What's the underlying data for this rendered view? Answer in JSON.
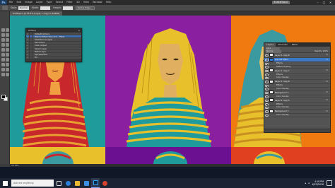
{
  "app": {
    "logo": "Ps",
    "menus": [
      "File",
      "Edit",
      "Image",
      "Layer",
      "Type",
      "Select",
      "Filter",
      "3D",
      "View",
      "Window",
      "Help"
    ],
    "workspace": "ESSENTIALS",
    "window_controls": [
      "–",
      "□",
      "✕"
    ]
  },
  "options": {
    "style_label": "Style:",
    "style_value": "Normal",
    "width_label": "Width:",
    "height_label": "Height:",
    "refine_button": "Refine Edge..."
  },
  "document": {
    "tab_title": "Untitled-1 @ 33.3% (Layer 1 copy 4, RGB/8)"
  },
  "actions_panel": {
    "title": "Actions",
    "rows": [
      {
        "check": "✓",
        "label": "Default Actions",
        "selected": false
      },
      {
        "check": "✓",
        "label": "Warhol Effect (Pop Art) - FINAL",
        "selected": true
      },
      {
        "check": "✓",
        "label": "Selection to Layer",
        "selected": false
      },
      {
        "check": "✓",
        "label": "Set Colors",
        "selected": false
      },
      {
        "check": "✓",
        "label": "Color Adjust",
        "selected": false
      },
      {
        "check": "✓",
        "label": "Select Layer",
        "selected": false
      },
      {
        "check": "✓",
        "label": "Make Layer",
        "selected": false
      },
      {
        "check": "✓",
        "label": "Set Selection",
        "selected": false
      },
      {
        "check": "✓",
        "label": "Fill",
        "selected": false
      }
    ]
  },
  "layers_panel": {
    "tabs": [
      "Layers",
      "Channels",
      "Paths"
    ],
    "kind": "Kind",
    "mode": "Normal",
    "opacity": "Opacity: 100%",
    "fill": "Fill: 100%",
    "rows": [
      {
        "name": "Layer 1 copy 8",
        "type": "layer",
        "thumb": "white",
        "selected": false
      },
      {
        "name": "pop art effect",
        "type": "layer",
        "thumb": "blue",
        "selected": true
      },
      {
        "name": "Effects",
        "type": "sub",
        "selected": false
      },
      {
        "name": "Pattern Overlay",
        "type": "sub",
        "selected": false
      },
      {
        "name": "Layer 1 copy 7",
        "type": "layer",
        "thumb": "white",
        "selected": false
      },
      {
        "name": "Effects",
        "type": "sub",
        "selected": false
      },
      {
        "name": "Color Overlay",
        "type": "sub",
        "selected": false
      },
      {
        "name": "Layer 1 copy 6",
        "type": "layer",
        "thumb": "white",
        "selected": false
      },
      {
        "name": "Effects",
        "type": "sub",
        "selected": false
      },
      {
        "name": "Color Overlay",
        "type": "sub",
        "selected": false
      },
      {
        "name": "Background 4",
        "type": "layer",
        "thumb": "white",
        "selected": false
      },
      {
        "name": "Color Overlay",
        "type": "sub",
        "selected": false
      },
      {
        "name": "Layer 1 copy 5",
        "type": "layer",
        "thumb": "white",
        "selected": false
      },
      {
        "name": "Effects",
        "type": "sub",
        "selected": false
      },
      {
        "name": "Color Overlay",
        "type": "sub",
        "selected": false
      },
      {
        "name": "Background 3",
        "type": "layer",
        "thumb": "white",
        "selected": false
      },
      {
        "name": "Color Overlay",
        "type": "sub",
        "selected": false
      }
    ]
  },
  "status": {
    "zoom": "33.33%"
  },
  "taskbar": {
    "search_placeholder": "Ask me anything",
    "time": "4:18 PM",
    "date": "6/22/2016"
  },
  "colors": {
    "teal": "#1f9b9b",
    "magenta": "#8a1fa0",
    "orange": "#f07a10",
    "hair_red": "#c8282c",
    "hair_yellow": "#e8c02c",
    "hair_teal": "#3a9aa0",
    "skin_orange": "#f0a040",
    "skin_light": "#e0b060"
  }
}
